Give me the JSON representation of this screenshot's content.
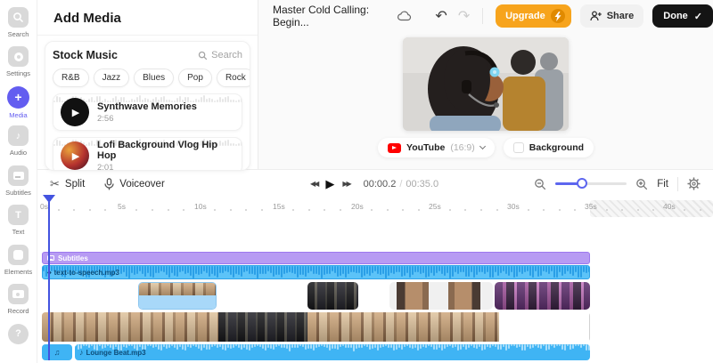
{
  "icons": {
    "check": "✓",
    "scissors": "✂",
    "play": "▶",
    "rewind": "◀◀",
    "forward": "▶▶",
    "note": "♪",
    "notes": "♫",
    "diamond": "◆",
    "dots": "⋯",
    "help": "?",
    "plus": "+",
    "text_glyph": "T",
    "undo": "↶",
    "redo": "↷"
  },
  "sidebar": {
    "items": [
      {
        "label": "Search"
      },
      {
        "label": "Settings"
      },
      {
        "label": "Media"
      },
      {
        "label": "Audio"
      },
      {
        "label": "Subtitles"
      },
      {
        "label": "Text"
      },
      {
        "label": "Elements"
      },
      {
        "label": "Record"
      }
    ],
    "active_item": "Media"
  },
  "panel": {
    "title": "Add Media",
    "stock_music": {
      "heading": "Stock Music",
      "search_label": "Search",
      "genres": [
        "R&B",
        "Jazz",
        "Blues",
        "Pop",
        "Rock"
      ],
      "tracks": [
        {
          "title": "Synthwave Memories",
          "duration": "2:56"
        },
        {
          "title": "Lofi Background Vlog Hip Hop",
          "duration": "2:01"
        }
      ]
    }
  },
  "topbar": {
    "project_title": "Master Cold Calling: Begin...",
    "upgrade_label": "Upgrade",
    "share_label": "Share",
    "done_label": "Done"
  },
  "preview": {
    "format_label": "YouTube",
    "aspect_label": "(16:9)",
    "background_label": "Background"
  },
  "timeline": {
    "split_label": "Split",
    "voiceover_label": "Voiceover",
    "current_time": "00:00.2",
    "time_separator": "/",
    "total_time": "00:35.0",
    "fit_label": "Fit",
    "ruler_labels": [
      "0s",
      "5s",
      "10s",
      "15s",
      "20s",
      "25s",
      "30s",
      "35s",
      "40s"
    ],
    "tracks": {
      "subtitles_label": "Subtitles",
      "tts_label": "text-to-speech.mp3",
      "music_label": "Lounge Beat.mp3"
    }
  },
  "colors": {
    "accent_purple": "#635df0",
    "accent_orange": "#f7a41c",
    "track_blue": "#3fb4f4",
    "track_purple": "#b79bf3",
    "playhead": "#4353e0"
  }
}
